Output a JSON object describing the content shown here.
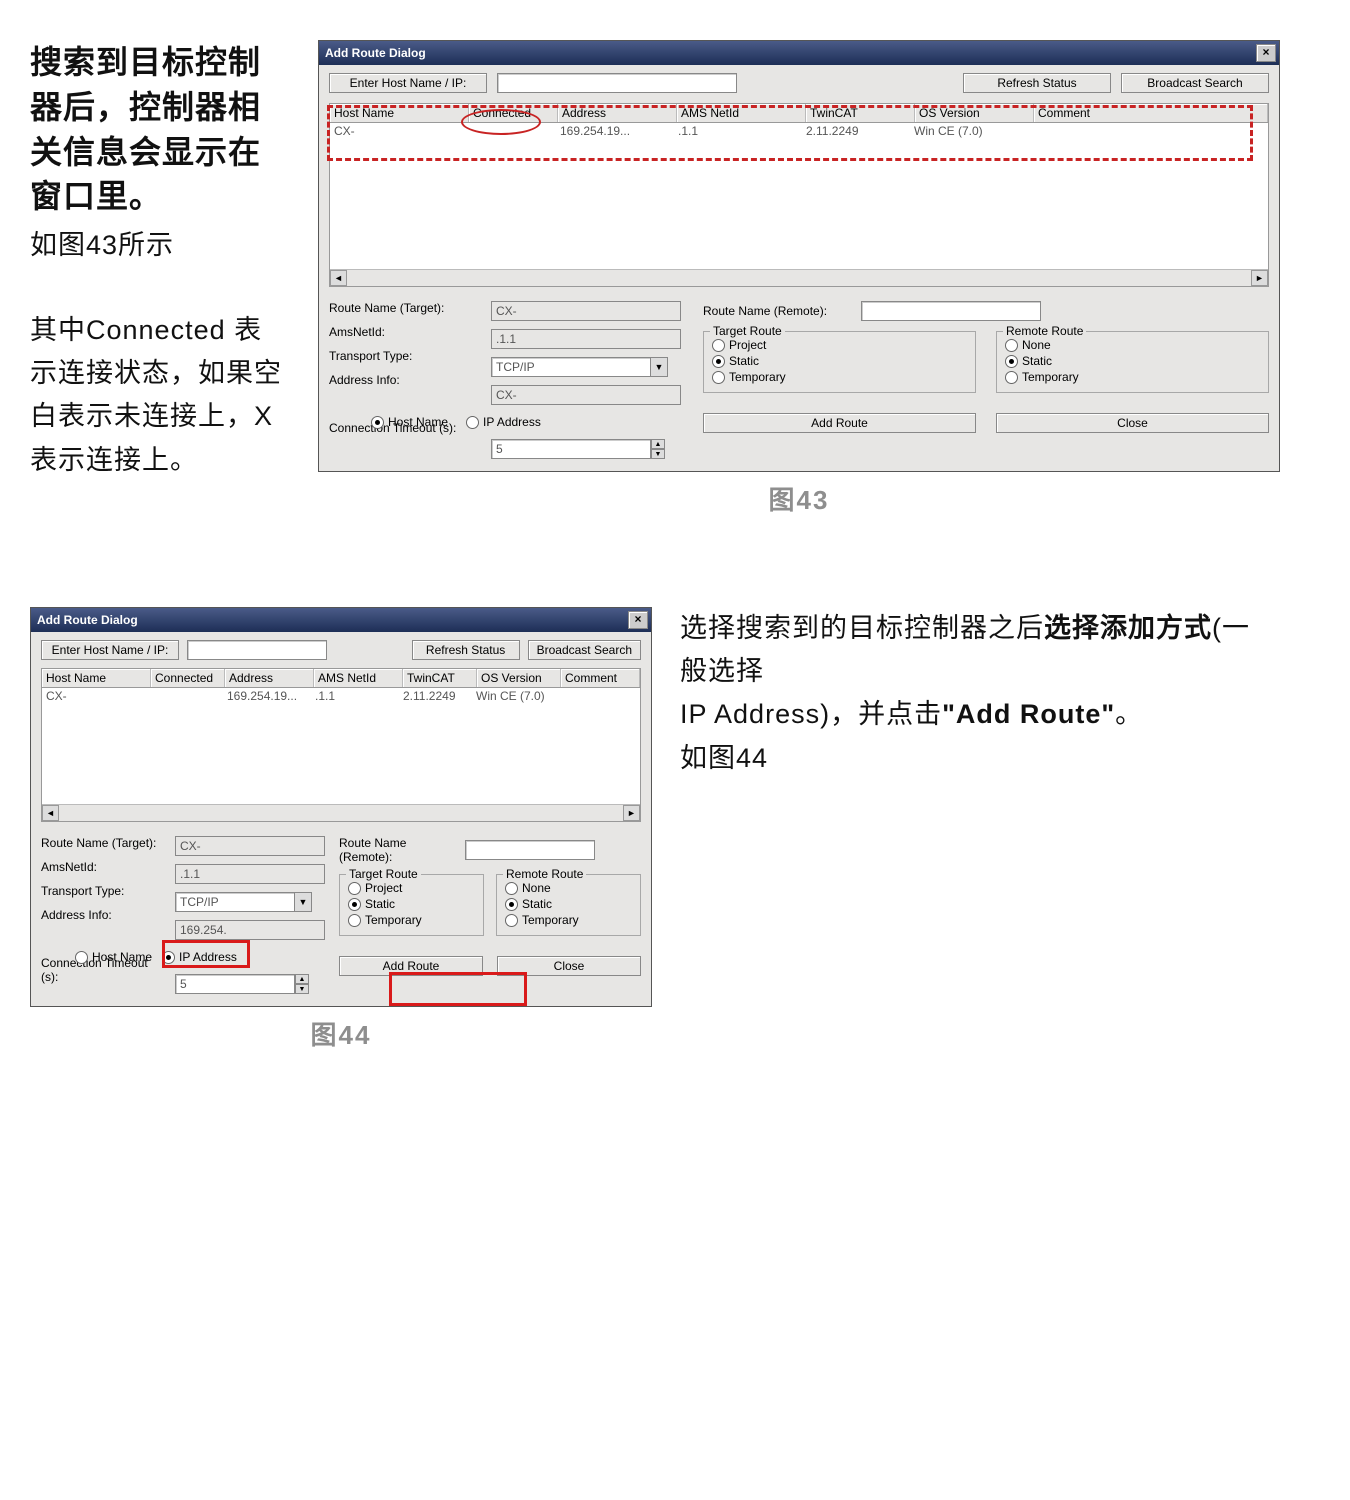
{
  "text43": {
    "heading": "搜索到目标控制器后，控制器相关信息会显示在窗口里。",
    "sub": "如图43所示",
    "para": "其中Connected 表示连接状态，如果空白表示未连接上，X 表示连接上。"
  },
  "text44": {
    "l1": "选择搜索到的目标控制器之后",
    "l1b": "选择添加方式",
    "l2": "(一般选择",
    "l3": "IP Address)，并点击",
    "l3b": "\"Add Route\"",
    "l3c": "。",
    "l4": "如图44"
  },
  "dlg": {
    "title": "Add Route Dialog",
    "enter_hostip": "Enter Host Name / IP:",
    "refresh": "Refresh Status",
    "broadcast": "Broadcast Search",
    "cols": {
      "host": "Host Name",
      "conn": "Connected",
      "addr": "Address",
      "ams": "AMS NetId",
      "twin": "TwinCAT",
      "os": "OS Version",
      "comment": "Comment"
    },
    "row": {
      "host": "CX-",
      "conn": "",
      "addr": "169.254.19...",
      "ams": ".1.1",
      "twin": "2.11.2249",
      "os": "Win CE (7.0)",
      "comment": ""
    },
    "form": {
      "routeTarget": "Route Name (Target):",
      "routeTarget_v": "CX-",
      "ams": "AmsNetId:",
      "ams_v": ".1.1",
      "transport": "Transport Type:",
      "transport_v": "TCP/IP",
      "addrinfo": "Address Info:",
      "addrinfo_v43": "CX-",
      "addrinfo_v44": "169.254.",
      "hostname": "Host Name",
      "ipaddr": "IP Address",
      "timeout": "Connection Timeout (s):",
      "timeout_v": "5",
      "routeRemote": "Route Name (Remote):",
      "routeRemote_v": "",
      "targetRoute": "Target Route",
      "remoteRoute": "Remote Route",
      "project": "Project",
      "static": "Static",
      "temporary": "Temporary",
      "none": "None",
      "addRoute": "Add Route",
      "close": "Close"
    }
  },
  "caption43": "图43",
  "caption44": "图44"
}
